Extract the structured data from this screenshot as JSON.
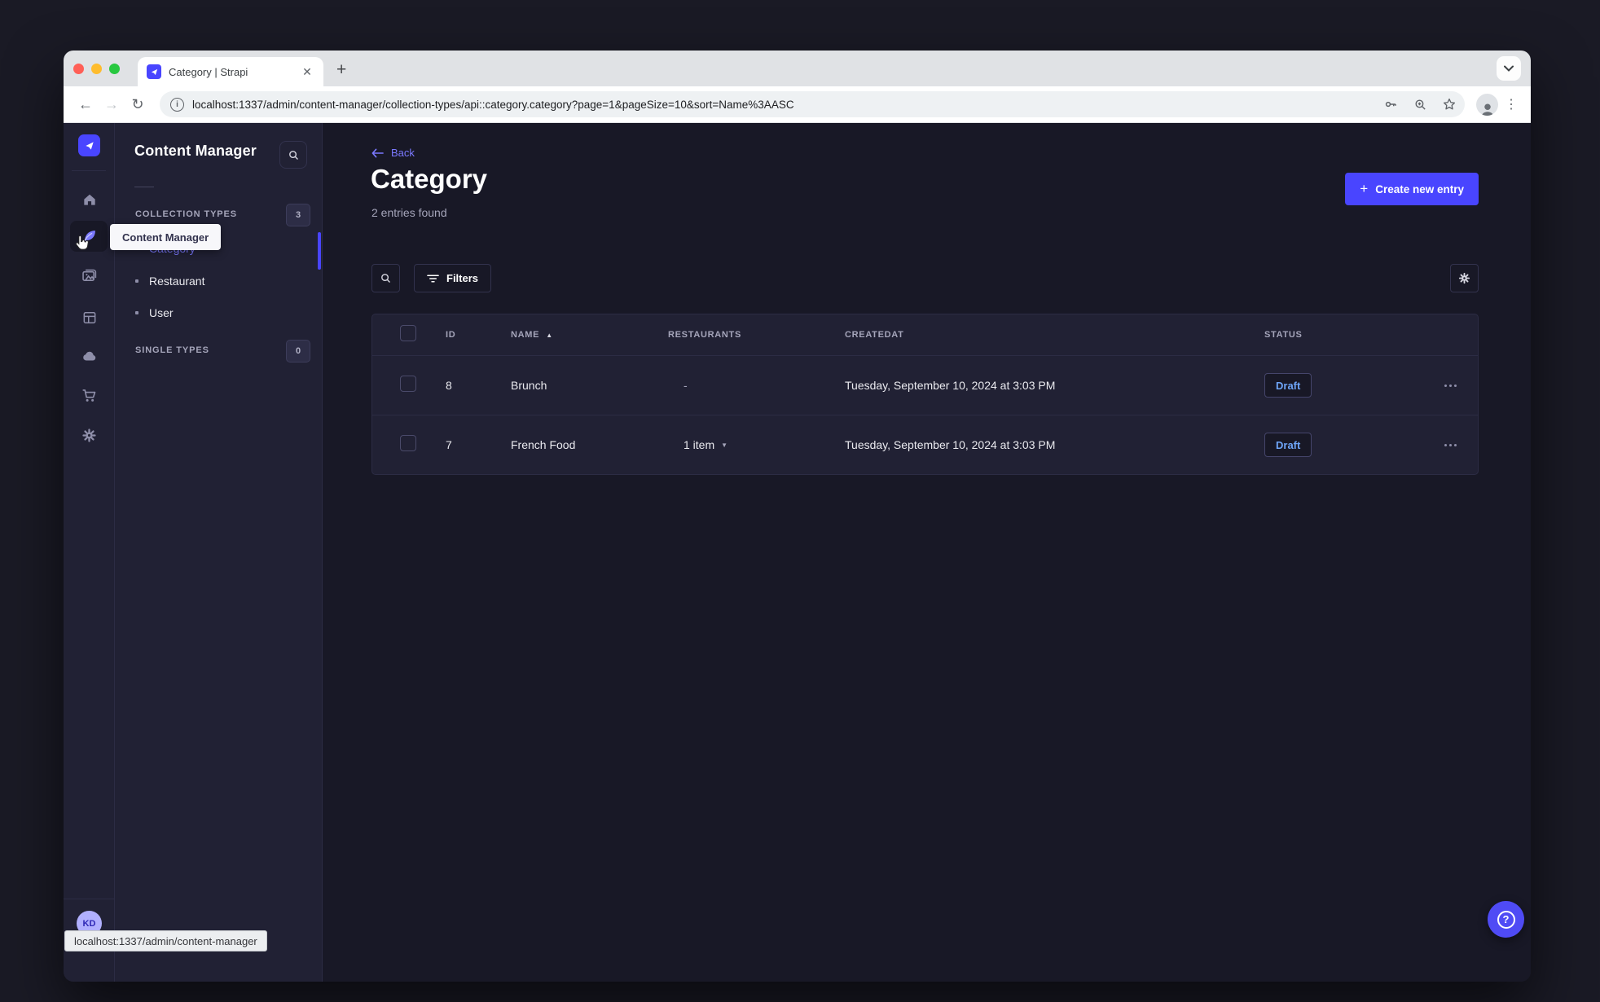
{
  "browser": {
    "tab_title": "Category | Strapi",
    "url": "localhost:1337/admin/content-manager/collection-types/api::category.category?page=1&pageSize=10&sort=Name%3AASC",
    "status_bar": "localhost:1337/admin/content-manager"
  },
  "nav": {
    "tooltip": "Content Manager",
    "avatar_initials": "KD"
  },
  "subnav": {
    "title": "Content Manager",
    "sections": [
      {
        "label": "COLLECTION TYPES",
        "count": "3",
        "items": [
          {
            "label": "Category"
          },
          {
            "label": "Restaurant"
          },
          {
            "label": "User"
          }
        ]
      },
      {
        "label": "SINGLE TYPES",
        "count": "0",
        "items": []
      }
    ]
  },
  "main": {
    "back_label": "Back",
    "title": "Category",
    "subtitle": "2 entries found",
    "create_button": "Create new entry",
    "filters_button": "Filters"
  },
  "table": {
    "headers": {
      "id": "ID",
      "name": "NAME",
      "restaurants": "RESTAURANTS",
      "createdat": "CREATEDAT",
      "status": "STATUS"
    },
    "rows": [
      {
        "id": "8",
        "name": "Brunch",
        "restaurants": "-",
        "createdat": "Tuesday, September 10, 2024 at 3:03 PM",
        "status": "Draft"
      },
      {
        "id": "7",
        "name": "French Food",
        "restaurants": "1 item",
        "createdat": "Tuesday, September 10, 2024 at 3:03 PM",
        "status": "Draft"
      }
    ]
  },
  "colors": {
    "accent": "#4945ff",
    "accent_light": "#7b79ff",
    "status_draft_text": "#6ea5f8",
    "app_bg": "#181826",
    "panel_bg": "#212134"
  }
}
